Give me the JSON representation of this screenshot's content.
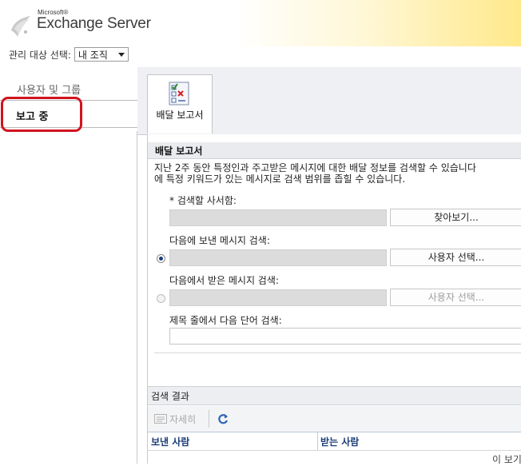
{
  "header": {
    "brand_small": "Microsoft®",
    "product": "Exchange Server"
  },
  "scope": {
    "label": "관리 대상 선택:",
    "value": "내 조직"
  },
  "nav": {
    "items": [
      {
        "label": "사용자 및 그룹"
      },
      {
        "label": "보고 중"
      }
    ]
  },
  "tab": {
    "label": "배달 보고서",
    "icon": "report-checklist-icon"
  },
  "report": {
    "title": "배달 보고서",
    "desc_line1": "지난 2주 동안 특정인과 주고받은 메시지에 대한 배달 정보를 검색할 수 있습니다",
    "desc_line2": "에 특정 키워드가 있는 메시지로 검색 범위를 좁힐 수 있습니다.",
    "mailbox_label": "* 검색할 사서함:",
    "browse_button": "찾아보기...",
    "sent_label": "다음에 보낸 메시지 검색:",
    "received_label": "다음에서 받은 메시지 검색:",
    "select_user_button": "사용자 선택...",
    "subject_label": "제목 줄에서 다음 단어 검색:"
  },
  "results": {
    "title": "검색 결과",
    "details_button": "자세히",
    "columns": [
      "보낸 사람",
      "받는 사람"
    ],
    "empty_message": "이 보기"
  },
  "colors": {
    "highlight": "#d0141f",
    "column_header": "#1c3d77"
  }
}
